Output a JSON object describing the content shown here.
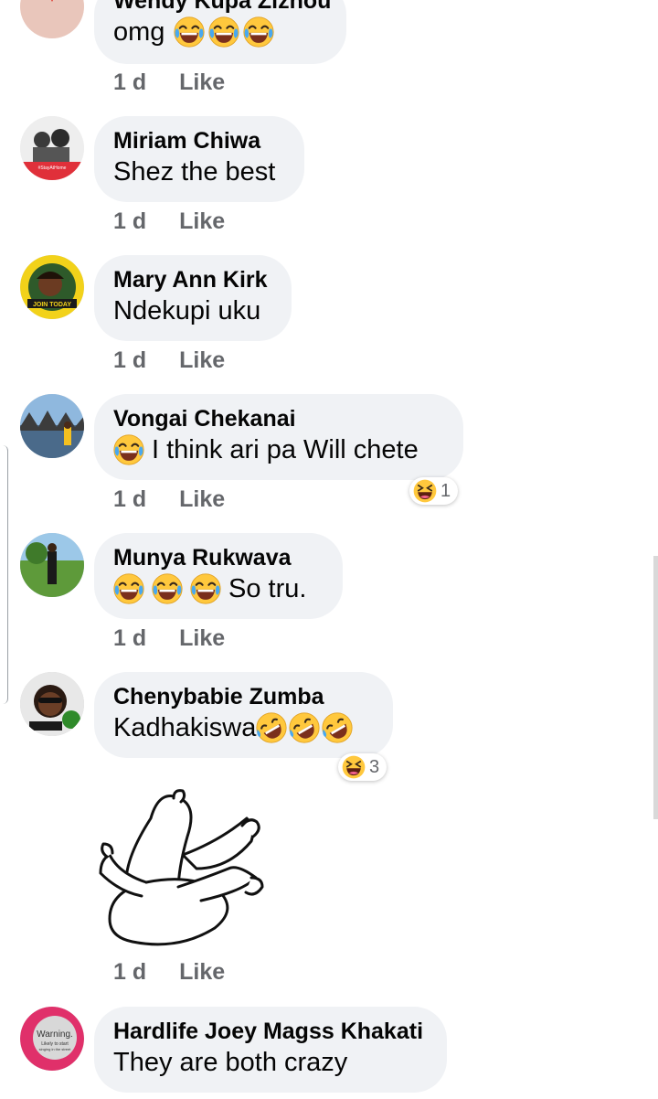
{
  "comments": [
    {
      "name": "Wendy Kupa Ziznou",
      "text": "omg",
      "time": "1 d",
      "like": "Like"
    },
    {
      "name": "Miriam Chiwa",
      "text": "Shez the best",
      "time": "1 d",
      "like": "Like"
    },
    {
      "name": "Mary Ann Kirk",
      "text": "Ndekupi uku",
      "time": "1 d",
      "like": "Like"
    },
    {
      "name": "Vongai Chekanai",
      "text": "I think ari pa Will chete",
      "time": "1 d",
      "like": "Like",
      "reaction_count": "1"
    },
    {
      "name": "Munya Rukwava",
      "text": "So tru.",
      "time": "1 d",
      "like": "Like"
    },
    {
      "name": "Chenybabie Zumba",
      "text": "Kadhakiswa",
      "time": "1 d",
      "like": "Like",
      "reaction_count": "3"
    },
    {
      "name": "Hardlife Joey Magss Khakati",
      "text": "They are both crazy"
    }
  ],
  "avatar_texts": {
    "miriam": "#StayAtHome",
    "mary": "JOIN TODAY",
    "hardlife_main": "Warning.",
    "hardlife_sub1": "Likely to start",
    "hardlife_sub2": "singing in the street"
  },
  "icons": {
    "joy": "face-with-tears-of-joy",
    "rofl": "rolling-on-floor-laughing",
    "haha": "haha-reaction",
    "sticker": "laughing-cartoon-sticker"
  },
  "colors": {
    "bubble": "#f0f2f5",
    "meta": "#65676b",
    "emoji_yellow": "#ffc83d"
  }
}
